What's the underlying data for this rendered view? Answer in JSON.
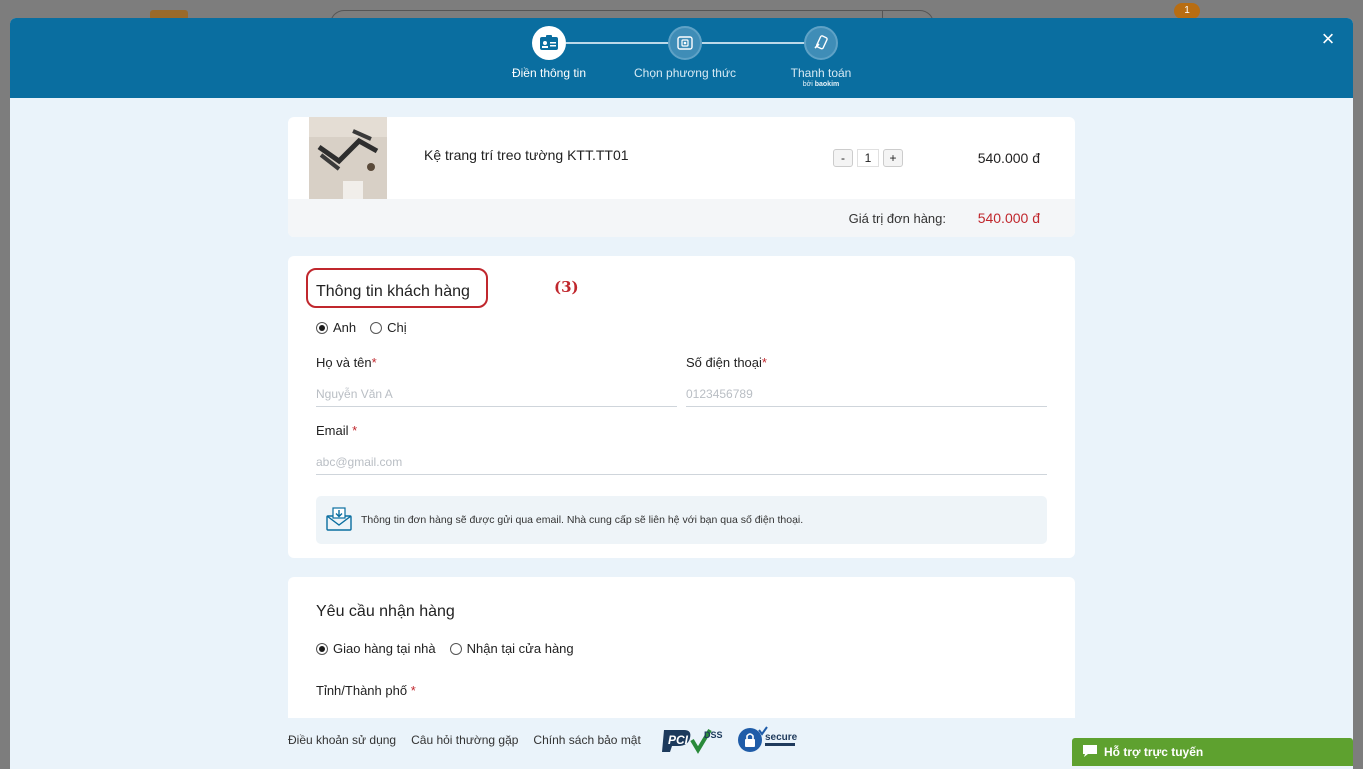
{
  "background": {
    "cart_count": "1"
  },
  "steps": [
    {
      "label": "Điền thông tin",
      "icon": "id-card-icon",
      "active": true
    },
    {
      "label": "Chọn phương thức",
      "icon": "payment-method-icon",
      "active": false
    },
    {
      "label": "Thanh toán",
      "icon": "payment-icon",
      "active": false,
      "sub_prefix": "bởi",
      "sub_brand": "baokim"
    }
  ],
  "close_label": "×",
  "product": {
    "name": "Kệ trang trí treo tường KTT.TT01",
    "quantity": "1",
    "minus": "-",
    "plus": "+",
    "price": "540.000 đ",
    "total_label": "Giá trị đơn hàng:",
    "total_value": "540.000 đ"
  },
  "customer": {
    "title": "Thông tin khách hàng",
    "annotation": "(3)",
    "gender_options": [
      "Anh",
      "Chị"
    ],
    "gender_selected": "Anh",
    "name_label": "Họ và tên",
    "name_placeholder": "Nguyễn Văn A",
    "phone_label": "Số điện thoại",
    "phone_placeholder": "0123456789",
    "email_label": "Email",
    "email_placeholder": "abc@gmail.com",
    "required_mark": "*",
    "notice": "Thông tin đơn hàng sẽ được gửi qua email. Nhà cung cấp sẽ liên hệ với bạn qua số điện thoại."
  },
  "delivery": {
    "title": "Yêu cầu nhận hàng",
    "options": [
      "Giao hàng tại nhà",
      "Nhận tại cửa hàng"
    ],
    "selected": "Giao hàng tại nhà",
    "province_label": "Tỉnh/Thành phố"
  },
  "footer": {
    "links": [
      "Điều khoản sử dụng",
      "Câu hỏi thường gặp",
      "Chính sách bảo mật"
    ],
    "pci_text": "PCI",
    "dss_text": "DSS",
    "secure_text": "secure"
  },
  "support_label": "Hỗ trợ trực tuyến",
  "colors": {
    "header": "#0a6ea0",
    "accent_red": "#c0272d",
    "support_green": "#5ea12f"
  }
}
